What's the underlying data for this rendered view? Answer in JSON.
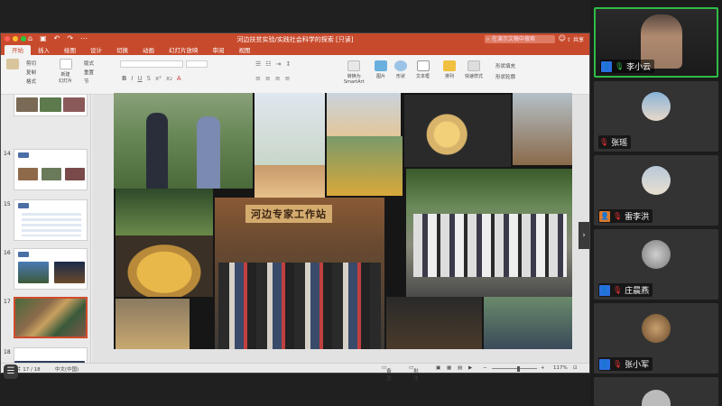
{
  "window": {
    "title": "河边扶贫实验/实践社会科学的探索 [只读]",
    "search_placeholder": "在演示文稿中搜索",
    "share_label": "共享"
  },
  "ribbon": {
    "tabs": [
      "开始",
      "插入",
      "绘图",
      "设计",
      "切换",
      "动画",
      "幻灯片放映",
      "审阅",
      "视图"
    ],
    "active_tab": "开始",
    "buttons": {
      "new_slide": "新建\n幻灯片",
      "layout": "版式",
      "reset": "重置",
      "section": "节",
      "cut": "剪切",
      "copy": "复制",
      "format": "格式",
      "convert_smartart": "转换为\nSmartArt",
      "picture": "图片",
      "shape": "形状",
      "textbox": "文本框",
      "arrange": "排列",
      "quick_styles": "快速样式",
      "shape_fill": "形状填充",
      "shape_outline": "形状轮廓"
    }
  },
  "thumbnails": [
    {
      "num": "",
      "selected": false
    },
    {
      "num": "14",
      "selected": false
    },
    {
      "num": "15",
      "selected": false
    },
    {
      "num": "16",
      "selected": false
    },
    {
      "num": "17",
      "selected": true
    },
    {
      "num": "18",
      "selected": false
    }
  ],
  "slide": {
    "banner_text": "河边专家工作站"
  },
  "status": {
    "slide_info": "幻灯片 17 / 18",
    "language": "中文(中国)",
    "notes": "备注",
    "comments": "批注",
    "zoom": "117%"
  },
  "participants": [
    {
      "name": "李小云",
      "muted": false,
      "active": true
    },
    {
      "name": "张瑶",
      "muted": true,
      "active": false
    },
    {
      "name": "雷李洪",
      "muted": true,
      "active": false
    },
    {
      "name": "庄晨燕",
      "muted": true,
      "active": false
    },
    {
      "name": "张小军",
      "muted": true,
      "active": false
    }
  ],
  "colors": {
    "accent": "#c84a2c",
    "active_speaker": "#2fbd46"
  }
}
